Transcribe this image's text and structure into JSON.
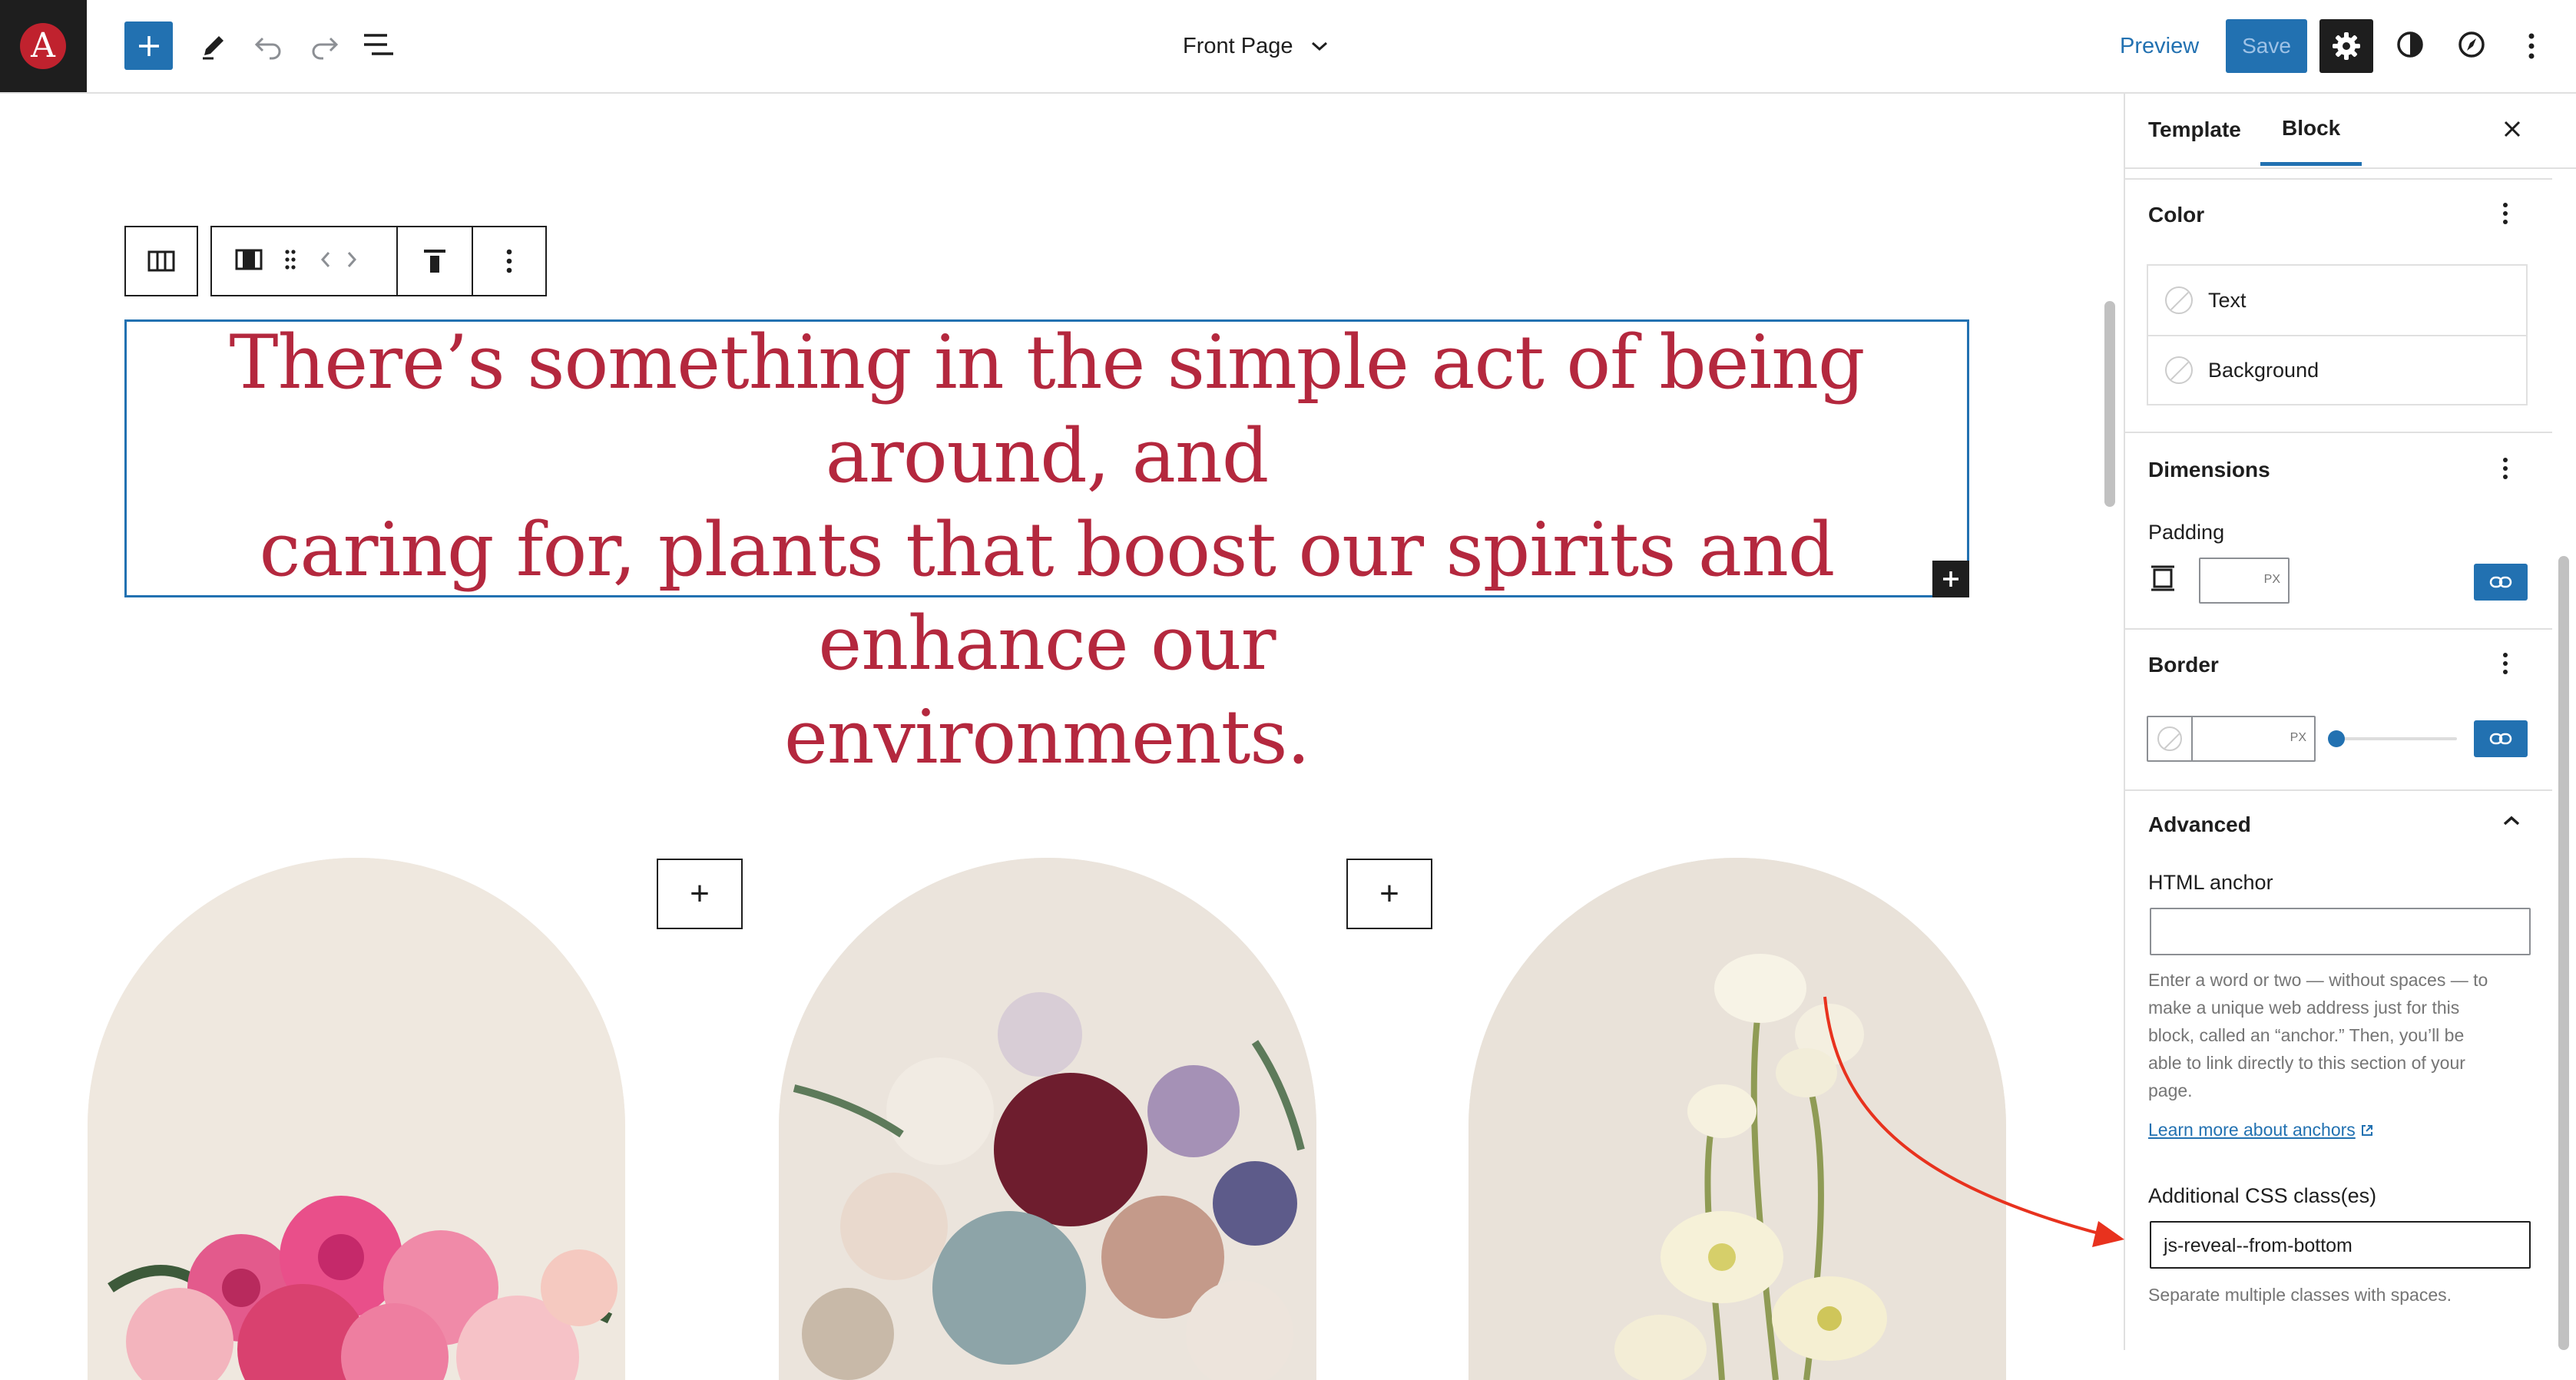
{
  "app": {
    "logo_letter": "A",
    "document_title": "Front Page",
    "preview_label": "Preview",
    "save_label": "Save",
    "accent_color": "#2271b1",
    "quote_color": "#b4283e"
  },
  "toolbar_icons": [
    "plus-icon",
    "pen-icon",
    "undo-icon",
    "redo-icon",
    "list-view-icon",
    "chevron-down-icon",
    "gear-icon",
    "half-circle-icon",
    "compass-icon",
    "more-vertical-icon"
  ],
  "block_toolbar_icons": [
    "columns-icon",
    "column-icon",
    "drag-handle-icon",
    "move-arrows-icon",
    "align-top-icon",
    "more-vertical-icon"
  ],
  "canvas": {
    "quote_lines": [
      "There’s something in the simple act of being around, and",
      "caring for, plants that boost our spirits and enhance our",
      "environments."
    ],
    "add_symbol": "+"
  },
  "sidebar": {
    "tabs": [
      {
        "label": "Template",
        "active": false
      },
      {
        "label": "Block",
        "active": true
      }
    ],
    "color": {
      "title": "Color",
      "items": [
        {
          "label": "Text"
        },
        {
          "label": "Background"
        }
      ]
    },
    "dimensions": {
      "title": "Dimensions",
      "padding_label": "Padding",
      "unit": "PX",
      "value": ""
    },
    "border": {
      "title": "Border",
      "unit": "PX",
      "width_value": "",
      "radius_slider": 0
    },
    "advanced": {
      "title": "Advanced",
      "html_anchor_label": "HTML anchor",
      "html_anchor_value": "",
      "anchor_help_lines": [
        "Enter a word or two — without spaces — to",
        "make a unique web address just for this",
        "block, called an “anchor.” Then, you’ll be",
        "able to link directly to this section of your",
        "page."
      ],
      "learn_more_link": "Learn more about anchors",
      "css_class_label": "Additional CSS class(es)",
      "css_class_value": "js-reveal--from-bottom",
      "css_help": "Separate multiple classes with spaces."
    }
  },
  "annotation": {
    "arrow_color": "#e8321e"
  }
}
